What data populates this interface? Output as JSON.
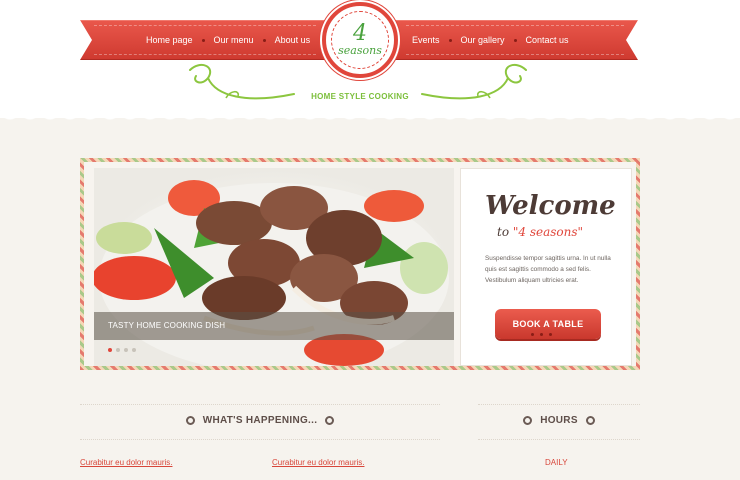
{
  "nav": {
    "left_items": [
      "Home page",
      "Our menu",
      "About us"
    ],
    "right_items": [
      "Events",
      "Our gallery",
      "Contact us"
    ]
  },
  "logo": {
    "number": "4",
    "word": "seasons"
  },
  "tagline": "HOME STYLE COOKING",
  "slider": {
    "caption": "TASTY HOME COOKING DISH",
    "dots_count": 4,
    "active_dot": 0
  },
  "welcome": {
    "title": "Welcome",
    "sub_prefix": "to",
    "sub_name": "\"4 seasons\"",
    "text": "Suspendisse tempor sagittis urna. In ut nulla quis est sagittis commodo a sed felis. Vestibulum aliquam ultricies erat.",
    "button": "BOOK A TABLE"
  },
  "sections": {
    "happening": "WHAT'S HAPPENING...",
    "hours": "HOURS"
  },
  "links": {
    "item1": "Curabitur eu dolor mauris.",
    "item2": "Curabitur eu dolor mauris.",
    "daily": "DAILY"
  },
  "colors": {
    "accent": "#e0463b",
    "green": "#7cbf3b",
    "background": "#f6f3ee"
  }
}
